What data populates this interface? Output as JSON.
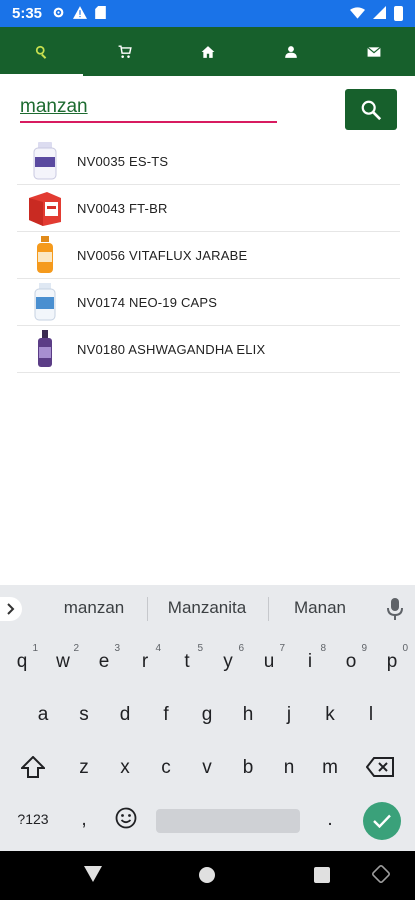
{
  "status_bar": {
    "time": "5:35",
    "icons_left": [
      "settings-icon",
      "alert-icon",
      "sd-card-icon"
    ],
    "icons_right": [
      "wifi-icon",
      "signal-icon",
      "battery-icon"
    ],
    "color": "#1a73e8"
  },
  "tabs": [
    {
      "name": "search",
      "icon": "search-icon",
      "active": true
    },
    {
      "name": "cart",
      "icon": "cart-icon",
      "active": false
    },
    {
      "name": "home",
      "icon": "home-icon",
      "active": false
    },
    {
      "name": "profile",
      "icon": "person-icon",
      "active": false
    },
    {
      "name": "messages",
      "icon": "mail-icon",
      "active": false
    }
  ],
  "search": {
    "value": "manzan",
    "button_icon": "search-icon"
  },
  "products": [
    {
      "code": "NV0035",
      "label": "NV0035 ES-TS",
      "thumb": "white-bottle"
    },
    {
      "code": "NV0043",
      "label": "NV0043 FT-BR",
      "thumb": "red-box"
    },
    {
      "code": "NV0056",
      "label": "NV0056 VITAFLUX JARABE",
      "thumb": "orange-bottle"
    },
    {
      "code": "NV0174",
      "label": "NV0174 NEO-19 CAPS",
      "thumb": "blue-bottle"
    },
    {
      "code": "NV0180",
      "label": "NV0180 ASHWAGANDHA ELIX",
      "thumb": "purple-bottle"
    }
  ],
  "keyboard": {
    "suggestions": [
      "manzan",
      "Manzanita",
      "Manan"
    ],
    "row1": [
      {
        "k": "q",
        "h": "1"
      },
      {
        "k": "w",
        "h": "2"
      },
      {
        "k": "e",
        "h": "3"
      },
      {
        "k": "r",
        "h": "4"
      },
      {
        "k": "t",
        "h": "5"
      },
      {
        "k": "y",
        "h": "6"
      },
      {
        "k": "u",
        "h": "7"
      },
      {
        "k": "i",
        "h": "8"
      },
      {
        "k": "o",
        "h": "9"
      },
      {
        "k": "p",
        "h": "0"
      }
    ],
    "row2": [
      "a",
      "s",
      "d",
      "f",
      "g",
      "h",
      "j",
      "k",
      "l"
    ],
    "row3": [
      "z",
      "x",
      "c",
      "v",
      "b",
      "n",
      "m"
    ],
    "symbols_label": "?123",
    "comma": ",",
    "period": "."
  },
  "colors": {
    "app_green": "#17602c",
    "active_tab_icon": "#c8e050",
    "input_underline": "#d81b60",
    "enter_key": "#3aa17a"
  }
}
